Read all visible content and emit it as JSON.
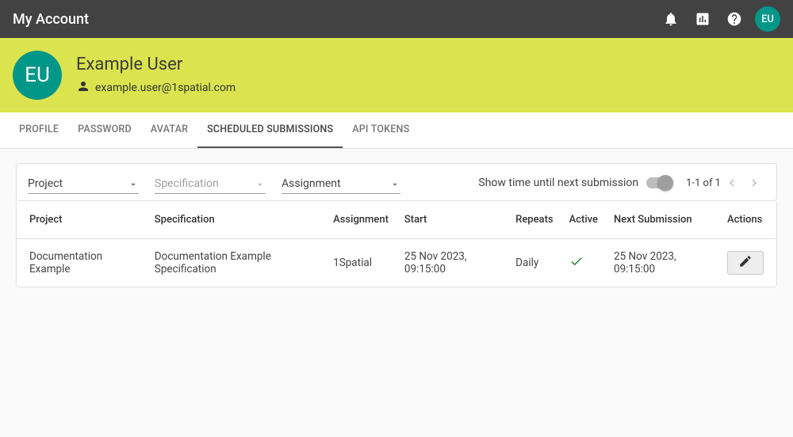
{
  "topbar": {
    "title": "My Account",
    "avatar_initials": "EU"
  },
  "banner": {
    "avatar_initials": "EU",
    "user_name": "Example User",
    "user_email": "example.user@1spatial.com"
  },
  "tabs": {
    "profile": "PROFILE",
    "password": "PASSWORD",
    "avatar": "AVATAR",
    "scheduled": "SCHEDULED SUBMISSIONS",
    "api_tokens": "API TOKENS"
  },
  "filters": {
    "project_label": "Project",
    "specification_placeholder": "Specification",
    "assignment_label": "Assignment"
  },
  "toggle": {
    "label": "Show time until next submission"
  },
  "pager": {
    "range": "1-1 of 1"
  },
  "table": {
    "headers": {
      "project": "Project",
      "specification": "Specification",
      "assignment": "Assignment",
      "start": "Start",
      "repeats": "Repeats",
      "active": "Active",
      "next_submission": "Next Submission",
      "actions": "Actions"
    },
    "rows": [
      {
        "project": "Documentation Example",
        "specification": "Documentation Example Specification",
        "assignment": "1Spatial",
        "start": "25 Nov 2023, 09:15:00",
        "repeats": "Daily",
        "active": true,
        "next_submission": "25 Nov 2023, 09:15:00"
      }
    ]
  }
}
